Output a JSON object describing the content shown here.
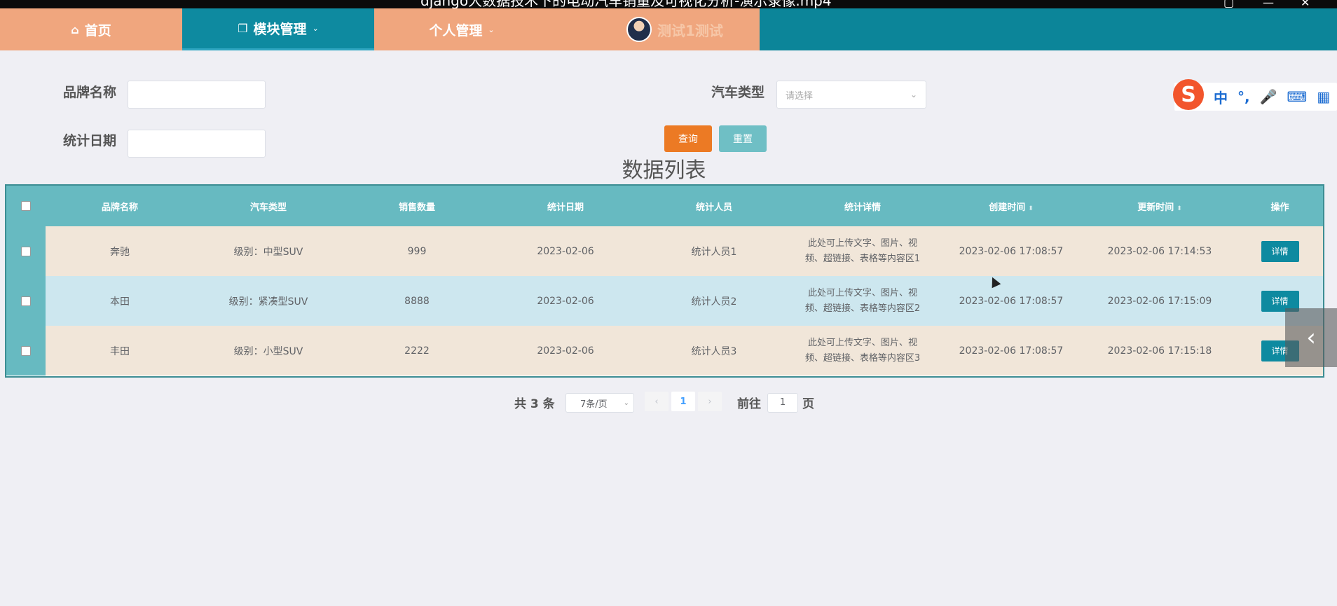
{
  "window": {
    "title": "django大数据技术下的电动汽车销量及可视化分析-演示录像.mp4",
    "controls": [
      "▢",
      "—",
      "✕"
    ]
  },
  "nav": {
    "home": "首页",
    "module": "模块管理",
    "personal": "个人管理",
    "username": "测试1测试"
  },
  "icons": {
    "home": "home-icon",
    "module": "copy-icon",
    "caret": "chevron-down-icon"
  },
  "search": {
    "brand_label": "品牌名称",
    "brand_value": "",
    "car_type_label": "汽车类型",
    "car_type_placeholder": "请选择",
    "date_label": "统计日期",
    "date_value": "",
    "query": "查询",
    "reset": "重置"
  },
  "list_title": "数据列表",
  "table": {
    "columns": [
      "品牌名称",
      "汽车类型",
      "销售数量",
      "统计日期",
      "统计人员",
      "统计详情",
      "创建时间",
      "更新时间",
      "操作"
    ],
    "rows": [
      {
        "brand": "奔驰",
        "type": "级别：中型SUV",
        "qty": "999",
        "date": "2023-02-06",
        "staff": "统计人员1",
        "detail_l1": "此处可上传文字、图片、视",
        "detail_l2": "频、超链接、表格等内容区1",
        "created": "2023-02-06 17:08:57",
        "updated": "2023-02-06 17:14:53",
        "action": "详情"
      },
      {
        "brand": "本田",
        "type": "级别：紧凑型SUV",
        "qty": "8888",
        "date": "2023-02-06",
        "staff": "统计人员2",
        "detail_l1": "此处可上传文字、图片、视",
        "detail_l2": "频、超链接、表格等内容区2",
        "created": "2023-02-06 17:08:57",
        "updated": "2023-02-06 17:15:09",
        "action": "详情"
      },
      {
        "brand": "丰田",
        "type": "级别：小型SUV",
        "qty": "2222",
        "date": "2023-02-06",
        "staff": "统计人员3",
        "detail_l1": "此处可上传文字、图片、视",
        "detail_l2": "频、超链接、表格等内容区3",
        "created": "2023-02-06 17:08:57",
        "updated": "2023-02-06 17:15:18",
        "action": "详情"
      }
    ]
  },
  "pagination": {
    "total": "共 3 条",
    "page_size": "7条/页",
    "prev": "‹",
    "current": "1",
    "next": "›",
    "goto_label": "前往",
    "goto_value": "1",
    "page_suffix": "页"
  },
  "ime": {
    "logo": "S",
    "items": [
      "中",
      "°,",
      "🎤",
      "⌨",
      "▦"
    ]
  },
  "side_toggle": "‹",
  "colors": {
    "nav_teal": "#0c8599",
    "nav_orange": "#f0a67e",
    "header_teal": "#67bac1",
    "row_beige": "#f1e6d9",
    "row_blue": "#cde7ef",
    "query_orange": "#ec7a24",
    "reset_teal": "#6fbfc5"
  }
}
